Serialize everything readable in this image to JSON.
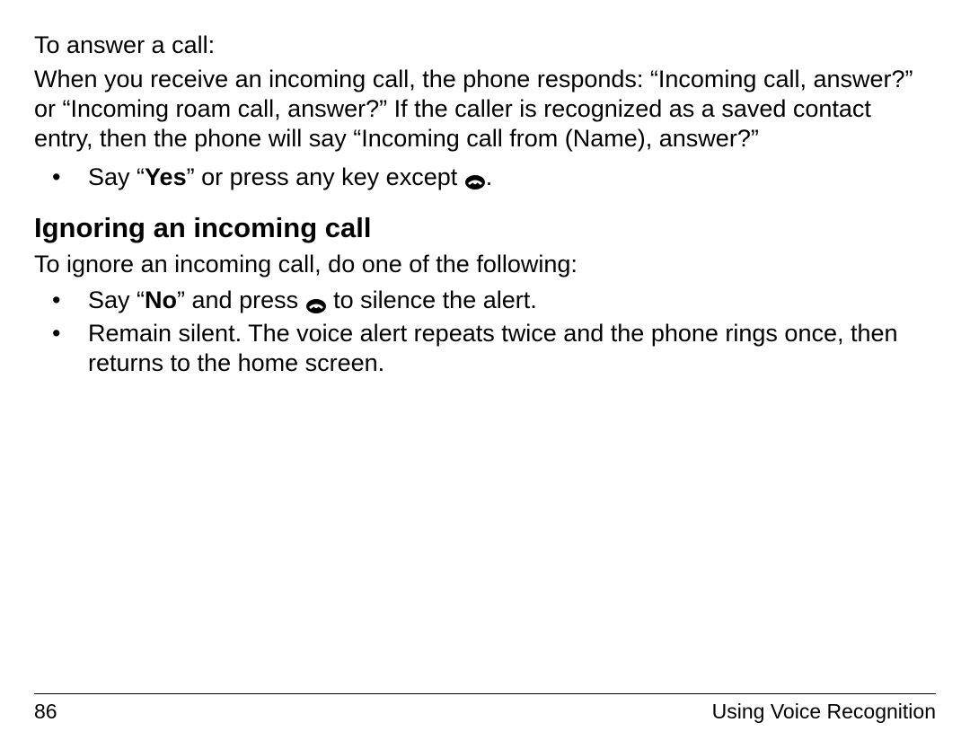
{
  "answer": {
    "intro": "To answer a call:",
    "para": "When you receive an incoming call, the phone responds: “Incoming call, answer?” or “Incoming roam call, answer?” If the caller is recognized as a saved contact entry, then the phone will say “Incoming call from (Name), answer?”",
    "bullet1_a": "Say “",
    "bullet1_bold": "Yes",
    "bullet1_b": "” or press any key except ",
    "bullet1_c": "."
  },
  "ignore": {
    "heading": "Ignoring an incoming call",
    "intro": "To ignore an incoming call, do one of the following:",
    "bullet1_a": "Say “",
    "bullet1_bold": "No",
    "bullet1_b": "” and press ",
    "bullet1_c": " to silence the alert.",
    "bullet2": "Remain silent. The voice alert repeats twice and the phone rings once, then returns to the home screen."
  },
  "footer": {
    "page": "86",
    "section": "Using Voice Recognition"
  }
}
